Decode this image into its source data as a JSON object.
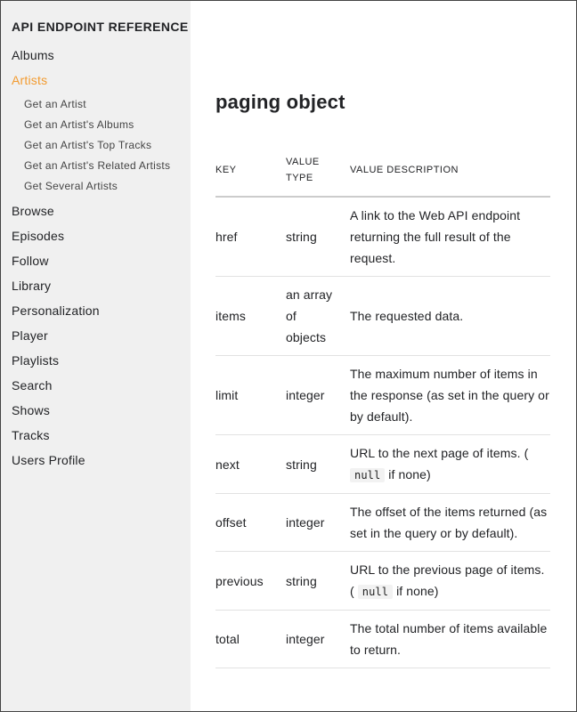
{
  "sidebar": {
    "title": "API ENDPOINT REFERENCE",
    "items": [
      {
        "label": "Albums"
      },
      {
        "label": "Artists",
        "active": true,
        "children": [
          "Get an Artist",
          "Get an Artist's Albums",
          "Get an Artist's Top Tracks",
          "Get an Artist's Related Artists",
          "Get Several Artists"
        ]
      },
      {
        "label": "Browse"
      },
      {
        "label": "Episodes"
      },
      {
        "label": "Follow"
      },
      {
        "label": "Library"
      },
      {
        "label": "Personalization"
      },
      {
        "label": "Player"
      },
      {
        "label": "Playlists"
      },
      {
        "label": "Search"
      },
      {
        "label": "Shows"
      },
      {
        "label": "Tracks"
      },
      {
        "label": "Users Profile"
      }
    ]
  },
  "main": {
    "title": "paging object",
    "table": {
      "headers": [
        "KEY",
        "VALUE TYPE",
        "VALUE DESCRIPTION"
      ],
      "rows": [
        {
          "key": "href",
          "type": "string",
          "desc": "A link to the Web API endpoint returning the full result of the request."
        },
        {
          "key": "items",
          "type": "an array of objects",
          "desc": "The requested data."
        },
        {
          "key": "limit",
          "type": "integer",
          "desc": "The maximum number of items in the response (as set in the query or by default)."
        },
        {
          "key": "next",
          "type": "string",
          "desc_pre": "URL to the next page of items. ( ",
          "desc_code": "null",
          "desc_post": " if none)"
        },
        {
          "key": "offset",
          "type": "integer",
          "desc": "The offset of the items returned (as set in the query or by default)."
        },
        {
          "key": "previous",
          "type": "string",
          "desc_pre": "URL to the previous page of items. ( ",
          "desc_code": "null",
          "desc_post": " if none)"
        },
        {
          "key": "total",
          "type": "integer",
          "desc": "The total number of items available to return."
        }
      ]
    }
  },
  "colors": {
    "active_nav": "#f29b30",
    "sidebar_bg": "#f0f0f0",
    "text": "#222326"
  }
}
